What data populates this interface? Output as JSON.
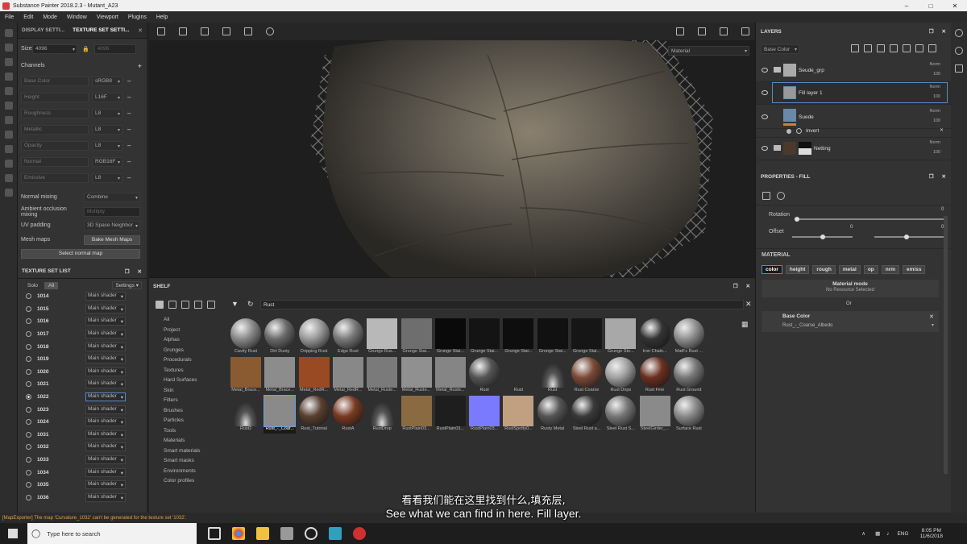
{
  "app": {
    "title": "Substance Painter 2018.2.3 - Mutant_A23",
    "menu": [
      "File",
      "Edit",
      "Mode",
      "Window",
      "Viewport",
      "Plugins",
      "Help"
    ]
  },
  "texset": {
    "tab1": "DISPLAY SETTI...",
    "tab2": "TEXTURE SET SETTI...",
    "size_label": "Size",
    "size_value": "4096",
    "size_lock_value": "4096",
    "channels_label": "Channels",
    "channels": [
      {
        "name": "Base Color",
        "fmt": "sRGB8"
      },
      {
        "name": "Height",
        "fmt": "L16F"
      },
      {
        "name": "Roughness",
        "fmt": "L8"
      },
      {
        "name": "Metallic",
        "fmt": "L8"
      },
      {
        "name": "Opacity",
        "fmt": "L8"
      },
      {
        "name": "Normal",
        "fmt": "RGB16F"
      },
      {
        "name": "Emissive",
        "fmt": "L8"
      }
    ],
    "normal_mixing_label": "Normal mixing",
    "normal_mixing": "Combine",
    "ao_mixing_label": "Ambient occlusion mixing",
    "ao_mixing": "Multiply",
    "uv_padding_label": "UV padding",
    "uv_padding": "3D Space Neighbor",
    "mesh_maps_label": "Mesh maps",
    "bake_btn": "Bake Mesh Maps",
    "select_normal": "Select normal map"
  },
  "tslist": {
    "title": "TEXTURE SET LIST",
    "solo": "Solo",
    "all": "All",
    "settings": "Settings",
    "rows": [
      {
        "n": "1014",
        "s": "Main shader"
      },
      {
        "n": "1015",
        "s": "Main shader"
      },
      {
        "n": "1016",
        "s": "Main shader"
      },
      {
        "n": "1017",
        "s": "Main shader"
      },
      {
        "n": "1018",
        "s": "Main shader"
      },
      {
        "n": "1019",
        "s": "Main shader"
      },
      {
        "n": "1020",
        "s": "Main shader"
      },
      {
        "n": "1021",
        "s": "Main shader"
      },
      {
        "n": "1022",
        "s": "Main shader",
        "sel": true
      },
      {
        "n": "1023",
        "s": "Main shader"
      },
      {
        "n": "1024",
        "s": "Main shader"
      },
      {
        "n": "1031",
        "s": "Main shader"
      },
      {
        "n": "1032",
        "s": "Main shader"
      },
      {
        "n": "1033",
        "s": "Main shader"
      },
      {
        "n": "1034",
        "s": "Main shader"
      },
      {
        "n": "1035",
        "s": "Main shader"
      },
      {
        "n": "1036",
        "s": "Main shader"
      }
    ]
  },
  "viewport": {
    "mode": "Material"
  },
  "shelf": {
    "title": "SHELF",
    "search": "Rust",
    "categories": [
      "All",
      "Project",
      "Alphas",
      "Grunges",
      "Procedurals",
      "Textures",
      "Hard Surfaces",
      "Skin",
      "Filters",
      "Brushes",
      "Particles",
      "Tools",
      "Materials",
      "Smart materials",
      "Smart masks",
      "Environments",
      "Color profiles"
    ],
    "items": [
      {
        "l": "Cavity Rust",
        "c": "#8a8a8a",
        "t": "ball"
      },
      {
        "l": "Dirt Dusty",
        "c": "#6a6a6a",
        "t": "ball"
      },
      {
        "l": "Dripping Rust",
        "c": "#9a9a9a",
        "t": "ball"
      },
      {
        "l": "Edge Rust",
        "c": "#7a7a7a",
        "t": "ball"
      },
      {
        "l": "Grunge Rus...",
        "c": "#b8b8b8",
        "t": "sq"
      },
      {
        "l": "Grunge Stai...",
        "c": "#6e6e6e",
        "t": "sq"
      },
      {
        "l": "Grunge Stai...",
        "c": "#0a0a0a",
        "t": "sq"
      },
      {
        "l": "Grunge Stai...",
        "c": "#141414",
        "t": "sq"
      },
      {
        "l": "Grunge Stai...",
        "c": "#0e0e0e",
        "t": "sq"
      },
      {
        "l": "Grunge Stai...",
        "c": "#111111",
        "t": "sq"
      },
      {
        "l": "Grunge Stai...",
        "c": "#161616",
        "t": "sq"
      },
      {
        "l": "Grunge Sto...",
        "c": "#a8a8a8",
        "t": "sq"
      },
      {
        "l": "Iron Chain...",
        "c": "#333333",
        "t": "ball"
      },
      {
        "l": "MatFx Rust ...",
        "c": "#909090",
        "t": "ball"
      },
      {
        "l": "Metal_Brace...",
        "c": "#8a5a30",
        "t": "sq"
      },
      {
        "l": "Metal_Brace...",
        "c": "#8c8c8c",
        "t": "sq"
      },
      {
        "l": "Metal_RedR...",
        "c": "#9a4a22",
        "t": "sq"
      },
      {
        "l": "Metal_RedR...",
        "c": "#888888",
        "t": "sq"
      },
      {
        "l": "Metal_Ruste...",
        "c": "#7a7a7a",
        "t": "sq"
      },
      {
        "l": "Metal_Ruste...",
        "c": "#909090",
        "t": "sq"
      },
      {
        "l": "Metal_Ruste...",
        "c": "#858585",
        "t": "sq"
      },
      {
        "l": "Rust",
        "c": "#555555",
        "t": "ball"
      },
      {
        "l": "Rust",
        "c": "#2f2f2f",
        "t": "none"
      },
      {
        "l": "Rust",
        "c": "#2f2f2f",
        "t": "light"
      },
      {
        "l": "Rust Coarse",
        "c": "#7a4a38",
        "t": "ball"
      },
      {
        "l": "Rust Drips",
        "c": "#a0a0a0",
        "t": "ball"
      },
      {
        "l": "Rust Fine",
        "c": "#6a3020",
        "t": "ball"
      },
      {
        "l": "Rust Ground",
        "c": "#777777",
        "t": "ball"
      },
      {
        "l": "Rust2",
        "c": "#2f2f2f",
        "t": "light"
      },
      {
        "l": "Rust_-_Coar...",
        "c": "#8a8a8a",
        "t": "sq",
        "sel": true
      },
      {
        "l": "Rust_Tutorial",
        "c": "#5a4030",
        "t": "ball"
      },
      {
        "l": "RustA",
        "c": "#7a3a22",
        "t": "ball"
      },
      {
        "l": "RustDrop",
        "c": "#2f2f2f",
        "t": "light"
      },
      {
        "l": "RustPlain03...",
        "c": "#8a6a40",
        "t": "sq"
      },
      {
        "l": "RustPlain03...",
        "c": "#1e1e1e",
        "t": "sq"
      },
      {
        "l": "RustPlain03...",
        "c": "#7a7aff",
        "t": "sq"
      },
      {
        "l": "RustSpotty0...",
        "c": "#c0a080",
        "t": "sq"
      },
      {
        "l": "Rusty Metal",
        "c": "#555555",
        "t": "ball"
      },
      {
        "l": "Steel Rust a...",
        "c": "#3a3a3a",
        "t": "ball"
      },
      {
        "l": "Steel Rust S...",
        "c": "#777777",
        "t": "ball"
      },
      {
        "l": "SteelGirder_...",
        "c": "#8a8a8a",
        "t": "sq"
      },
      {
        "l": "Surface Rust",
        "c": "#8a8a8a",
        "t": "ball"
      }
    ]
  },
  "layers": {
    "title": "LAYERS",
    "channel": "Base Color",
    "rows": [
      {
        "name": "Seude_grp",
        "blend": "Norm",
        "op": "100",
        "type": "folder"
      },
      {
        "name": "Fill layer 1",
        "blend": "Norm",
        "op": "100",
        "type": "fill",
        "sel": true
      },
      {
        "name": "Suede",
        "blend": "Norm",
        "op": "100",
        "type": "fill2"
      },
      {
        "name": "Invert",
        "type": "effect"
      },
      {
        "name": "Netting",
        "blend": "Norm",
        "op": "100",
        "type": "folder2"
      }
    ]
  },
  "props": {
    "title": "PROPERTIES - FILL",
    "rotation_label": "Rotation",
    "rotation_value": "0",
    "offset_label": "Offset",
    "offset_u": "0",
    "offset_v": "0",
    "material_label": "MATERIAL",
    "channels": [
      "color",
      "height",
      "rough",
      "metal",
      "op",
      "nrm",
      "emiss"
    ],
    "material_mode_label": "Material mode",
    "material_mode_value": "No Resource Selected",
    "or": "Or",
    "base_color_label": "Base Color",
    "base_color_value": "Rust_-_Coarse_Albedo"
  },
  "status": "[MapExporter] The map 'Curvature_1032' can't be generated for the texture set '1032'.",
  "subtitles": {
    "cn": "看看我们能在这里找到什么,填充层,",
    "en": "See what we can find in here. Fill layer."
  },
  "taskbar": {
    "search": "Type here to search",
    "lang": "ENG",
    "time": "8:05 PM",
    "date": "11/6/2018"
  }
}
